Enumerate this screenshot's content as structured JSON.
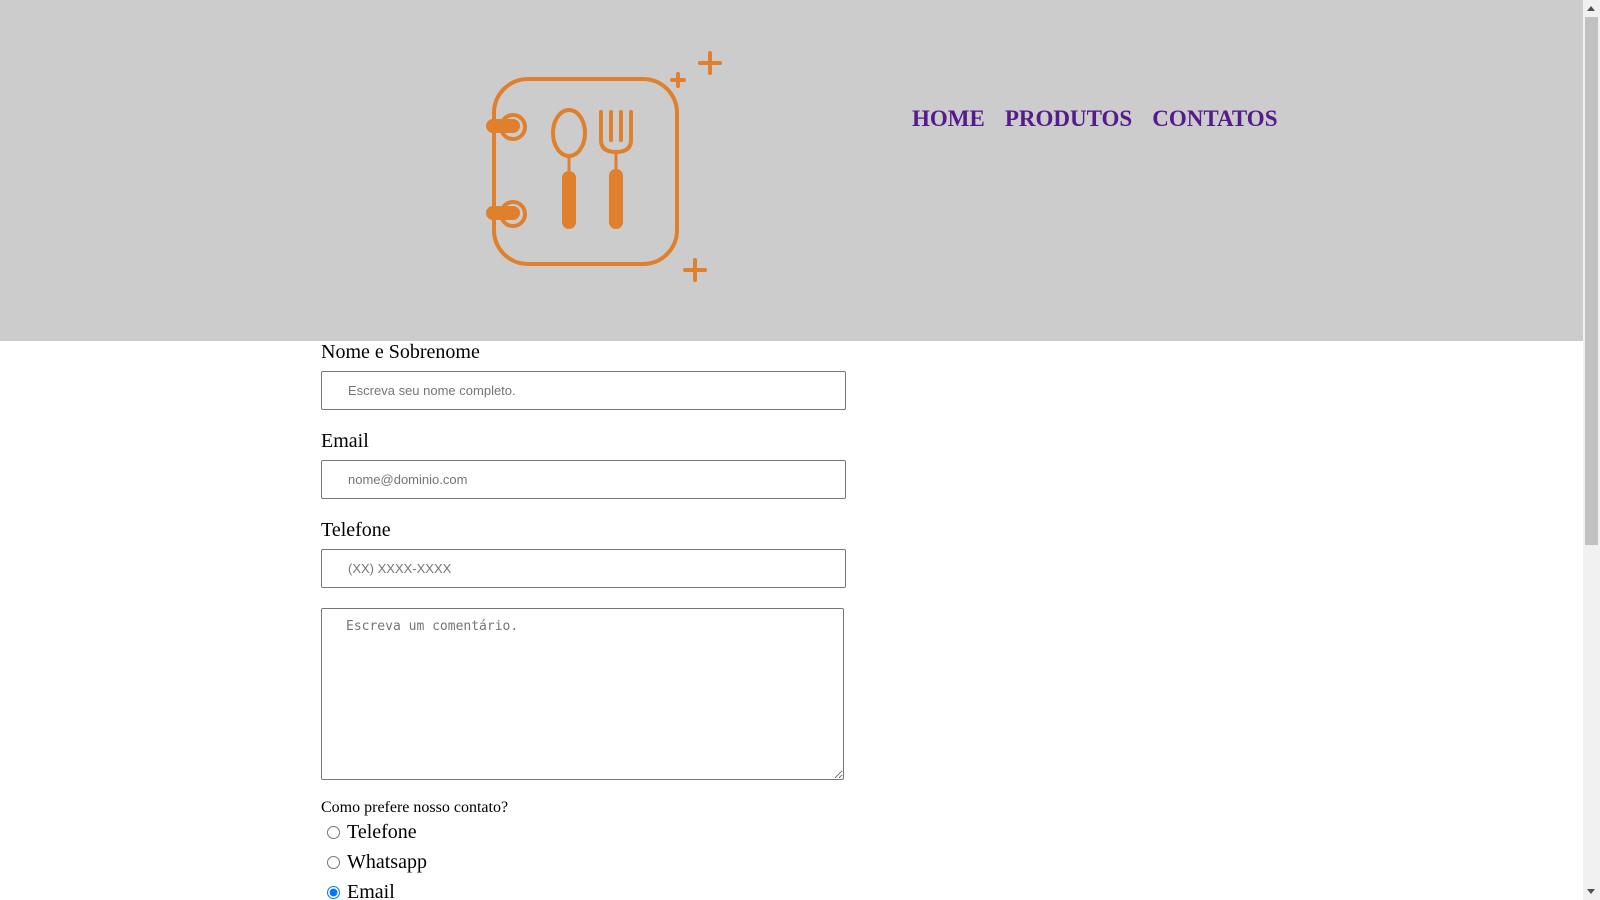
{
  "brand": {
    "logo_icon": "cookbook-spoon-fork-icon",
    "logo_color": "#e07f2c"
  },
  "nav": {
    "items": [
      {
        "label": "HOME"
      },
      {
        "label": "PRODUTOS"
      },
      {
        "label": "CONTATOS"
      }
    ],
    "color": "#551a8b"
  },
  "form": {
    "name_label": "Nome e Sobrenome",
    "name_placeholder": "Escreva seu nome completo.",
    "email_label": "Email",
    "email_placeholder": "nome@dominio.com",
    "phone_label": "Telefone",
    "phone_placeholder": "(XX) XXXX-XXXX",
    "comment_placeholder": "Escreva um comentário.",
    "contact_question": "Como prefere nosso contato?",
    "contact_options": [
      {
        "label": "Telefone",
        "selected": false
      },
      {
        "label": "Whatsapp",
        "selected": false
      },
      {
        "label": "Email",
        "selected": true
      }
    ]
  },
  "colors": {
    "header_bg": "#cccccc",
    "radio_accent": "#0075ff"
  }
}
